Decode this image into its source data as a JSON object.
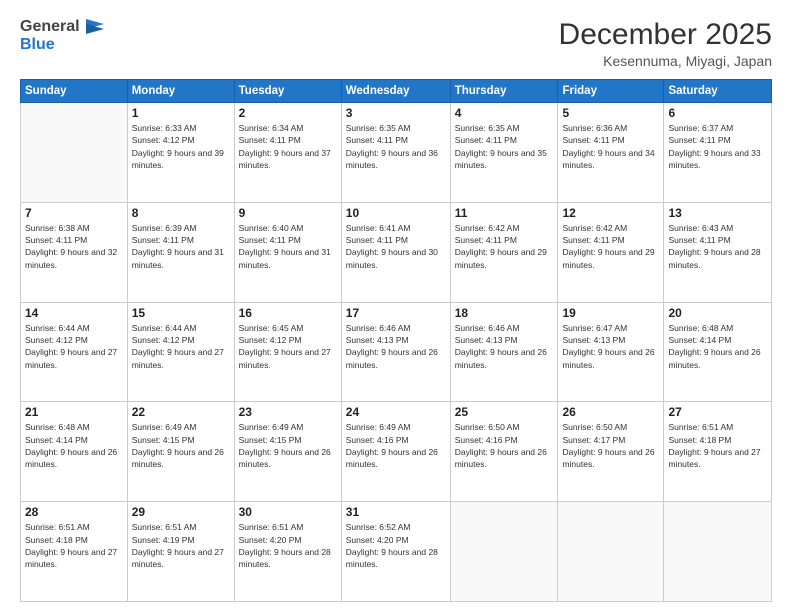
{
  "header": {
    "logo_general": "General",
    "logo_blue": "Blue",
    "month": "December 2025",
    "location": "Kesennuma, Miyagi, Japan"
  },
  "days_of_week": [
    "Sunday",
    "Monday",
    "Tuesday",
    "Wednesday",
    "Thursday",
    "Friday",
    "Saturday"
  ],
  "weeks": [
    [
      {
        "day": "",
        "sunrise": "",
        "sunset": "",
        "daylight": ""
      },
      {
        "day": "1",
        "sunrise": "Sunrise: 6:33 AM",
        "sunset": "Sunset: 4:12 PM",
        "daylight": "Daylight: 9 hours and 39 minutes."
      },
      {
        "day": "2",
        "sunrise": "Sunrise: 6:34 AM",
        "sunset": "Sunset: 4:11 PM",
        "daylight": "Daylight: 9 hours and 37 minutes."
      },
      {
        "day": "3",
        "sunrise": "Sunrise: 6:35 AM",
        "sunset": "Sunset: 4:11 PM",
        "daylight": "Daylight: 9 hours and 36 minutes."
      },
      {
        "day": "4",
        "sunrise": "Sunrise: 6:35 AM",
        "sunset": "Sunset: 4:11 PM",
        "daylight": "Daylight: 9 hours and 35 minutes."
      },
      {
        "day": "5",
        "sunrise": "Sunrise: 6:36 AM",
        "sunset": "Sunset: 4:11 PM",
        "daylight": "Daylight: 9 hours and 34 minutes."
      },
      {
        "day": "6",
        "sunrise": "Sunrise: 6:37 AM",
        "sunset": "Sunset: 4:11 PM",
        "daylight": "Daylight: 9 hours and 33 minutes."
      }
    ],
    [
      {
        "day": "7",
        "sunrise": "Sunrise: 6:38 AM",
        "sunset": "Sunset: 4:11 PM",
        "daylight": "Daylight: 9 hours and 32 minutes."
      },
      {
        "day": "8",
        "sunrise": "Sunrise: 6:39 AM",
        "sunset": "Sunset: 4:11 PM",
        "daylight": "Daylight: 9 hours and 31 minutes."
      },
      {
        "day": "9",
        "sunrise": "Sunrise: 6:40 AM",
        "sunset": "Sunset: 4:11 PM",
        "daylight": "Daylight: 9 hours and 31 minutes."
      },
      {
        "day": "10",
        "sunrise": "Sunrise: 6:41 AM",
        "sunset": "Sunset: 4:11 PM",
        "daylight": "Daylight: 9 hours and 30 minutes."
      },
      {
        "day": "11",
        "sunrise": "Sunrise: 6:42 AM",
        "sunset": "Sunset: 4:11 PM",
        "daylight": "Daylight: 9 hours and 29 minutes."
      },
      {
        "day": "12",
        "sunrise": "Sunrise: 6:42 AM",
        "sunset": "Sunset: 4:11 PM",
        "daylight": "Daylight: 9 hours and 29 minutes."
      },
      {
        "day": "13",
        "sunrise": "Sunrise: 6:43 AM",
        "sunset": "Sunset: 4:11 PM",
        "daylight": "Daylight: 9 hours and 28 minutes."
      }
    ],
    [
      {
        "day": "14",
        "sunrise": "Sunrise: 6:44 AM",
        "sunset": "Sunset: 4:12 PM",
        "daylight": "Daylight: 9 hours and 27 minutes."
      },
      {
        "day": "15",
        "sunrise": "Sunrise: 6:44 AM",
        "sunset": "Sunset: 4:12 PM",
        "daylight": "Daylight: 9 hours and 27 minutes."
      },
      {
        "day": "16",
        "sunrise": "Sunrise: 6:45 AM",
        "sunset": "Sunset: 4:12 PM",
        "daylight": "Daylight: 9 hours and 27 minutes."
      },
      {
        "day": "17",
        "sunrise": "Sunrise: 6:46 AM",
        "sunset": "Sunset: 4:13 PM",
        "daylight": "Daylight: 9 hours and 26 minutes."
      },
      {
        "day": "18",
        "sunrise": "Sunrise: 6:46 AM",
        "sunset": "Sunset: 4:13 PM",
        "daylight": "Daylight: 9 hours and 26 minutes."
      },
      {
        "day": "19",
        "sunrise": "Sunrise: 6:47 AM",
        "sunset": "Sunset: 4:13 PM",
        "daylight": "Daylight: 9 hours and 26 minutes."
      },
      {
        "day": "20",
        "sunrise": "Sunrise: 6:48 AM",
        "sunset": "Sunset: 4:14 PM",
        "daylight": "Daylight: 9 hours and 26 minutes."
      }
    ],
    [
      {
        "day": "21",
        "sunrise": "Sunrise: 6:48 AM",
        "sunset": "Sunset: 4:14 PM",
        "daylight": "Daylight: 9 hours and 26 minutes."
      },
      {
        "day": "22",
        "sunrise": "Sunrise: 6:49 AM",
        "sunset": "Sunset: 4:15 PM",
        "daylight": "Daylight: 9 hours and 26 minutes."
      },
      {
        "day": "23",
        "sunrise": "Sunrise: 6:49 AM",
        "sunset": "Sunset: 4:15 PM",
        "daylight": "Daylight: 9 hours and 26 minutes."
      },
      {
        "day": "24",
        "sunrise": "Sunrise: 6:49 AM",
        "sunset": "Sunset: 4:16 PM",
        "daylight": "Daylight: 9 hours and 26 minutes."
      },
      {
        "day": "25",
        "sunrise": "Sunrise: 6:50 AM",
        "sunset": "Sunset: 4:16 PM",
        "daylight": "Daylight: 9 hours and 26 minutes."
      },
      {
        "day": "26",
        "sunrise": "Sunrise: 6:50 AM",
        "sunset": "Sunset: 4:17 PM",
        "daylight": "Daylight: 9 hours and 26 minutes."
      },
      {
        "day": "27",
        "sunrise": "Sunrise: 6:51 AM",
        "sunset": "Sunset: 4:18 PM",
        "daylight": "Daylight: 9 hours and 27 minutes."
      }
    ],
    [
      {
        "day": "28",
        "sunrise": "Sunrise: 6:51 AM",
        "sunset": "Sunset: 4:18 PM",
        "daylight": "Daylight: 9 hours and 27 minutes."
      },
      {
        "day": "29",
        "sunrise": "Sunrise: 6:51 AM",
        "sunset": "Sunset: 4:19 PM",
        "daylight": "Daylight: 9 hours and 27 minutes."
      },
      {
        "day": "30",
        "sunrise": "Sunrise: 6:51 AM",
        "sunset": "Sunset: 4:20 PM",
        "daylight": "Daylight: 9 hours and 28 minutes."
      },
      {
        "day": "31",
        "sunrise": "Sunrise: 6:52 AM",
        "sunset": "Sunset: 4:20 PM",
        "daylight": "Daylight: 9 hours and 28 minutes."
      },
      {
        "day": "",
        "sunrise": "",
        "sunset": "",
        "daylight": ""
      },
      {
        "day": "",
        "sunrise": "",
        "sunset": "",
        "daylight": ""
      },
      {
        "day": "",
        "sunrise": "",
        "sunset": "",
        "daylight": ""
      }
    ]
  ]
}
